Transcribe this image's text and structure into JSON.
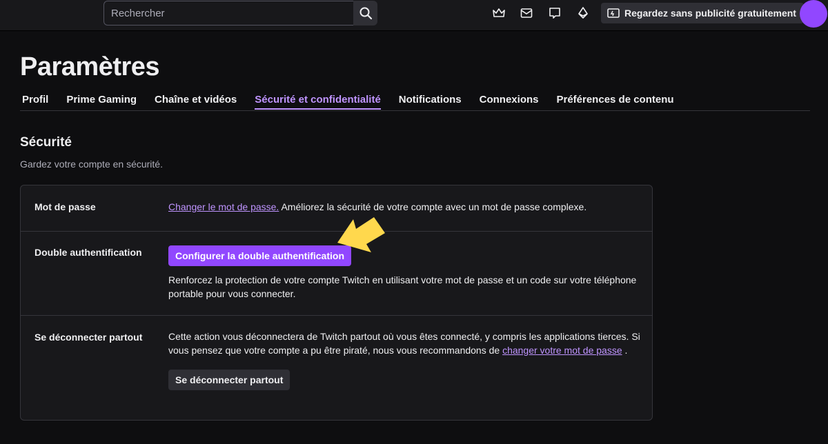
{
  "topbar": {
    "search_placeholder": "Rechercher",
    "adfree_label": "Regardez sans publicité gratuitement",
    "icons": [
      "crown-icon",
      "inbox-icon",
      "whispers-icon",
      "bits-icon",
      "ad-free-icon"
    ]
  },
  "page": {
    "title": "Paramètres",
    "tabs": [
      {
        "label": "Profil"
      },
      {
        "label": "Prime Gaming"
      },
      {
        "label": "Chaîne et vidéos"
      },
      {
        "label": "Sécurité et confidentialité"
      },
      {
        "label": "Notifications"
      },
      {
        "label": "Connexions"
      },
      {
        "label": "Préférences de contenu"
      }
    ],
    "active_tab": "Sécurité et confidentialité"
  },
  "security": {
    "title": "Sécurité",
    "subtitle": "Gardez votre compte en sécurité.",
    "password": {
      "label": "Mot de passe",
      "link": "Changer le mot de passe.",
      "text": " Améliorez la sécurité de votre compte avec un mot de passe complexe."
    },
    "twofa": {
      "label": "Double authentification",
      "button": "Configurer la double authentification",
      "text": "Renforcez la protection de votre compte Twitch en utilisant votre mot de passe et un code sur votre téléphone portable pour vous connecter."
    },
    "logout": {
      "label": "Se déconnecter partout",
      "text_1": "Cette action vous déconnectera de Twitch partout où vous êtes connecté, y compris les applications tierces. Si vous pensez que votre compte a pu être piraté, nous vous recommandons de ",
      "link": "changer votre mot de passe",
      "text_2": " .",
      "button": "Se déconnecter partout"
    }
  },
  "colors": {
    "accent": "#9147ff",
    "accent_light": "#bf94ff",
    "annotation_arrow": "#ffd84d"
  }
}
